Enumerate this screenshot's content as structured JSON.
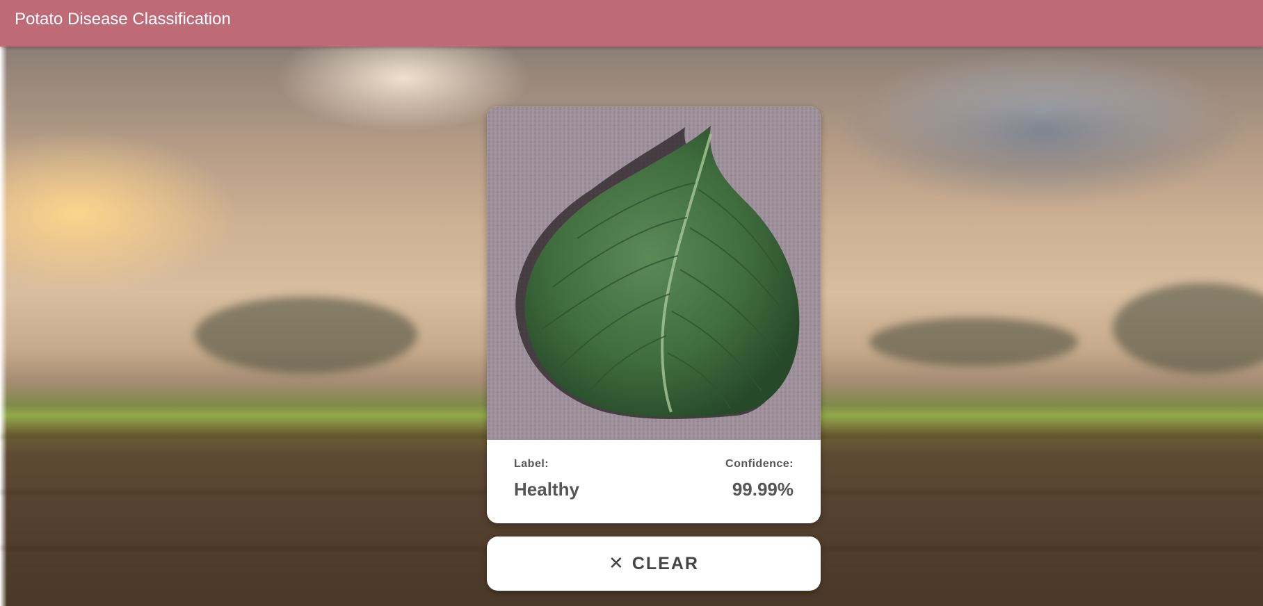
{
  "app": {
    "title": "Potato Disease Classification"
  },
  "result": {
    "label_caption": "Label:",
    "label_value": "Healthy",
    "confidence_caption": "Confidence:",
    "confidence_value": "99.99%"
  },
  "actions": {
    "clear_label": "CLEAR",
    "clear_icon": "close-icon"
  },
  "colors": {
    "appbar": "#be6a77",
    "text": "#555555",
    "card": "#ffffff"
  }
}
